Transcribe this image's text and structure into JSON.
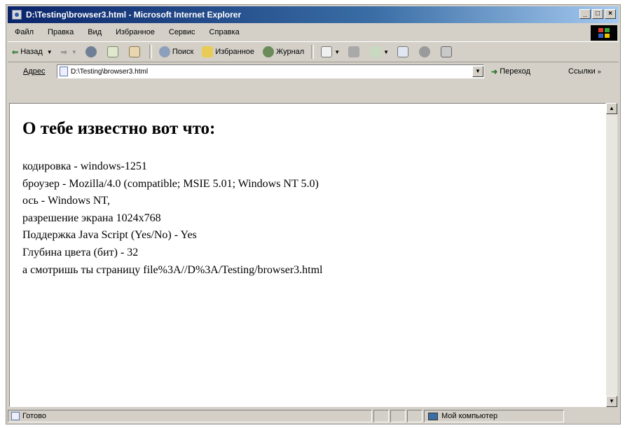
{
  "window": {
    "title": "D:\\Testing\\browser3.html - Microsoft Internet Explorer"
  },
  "menu": {
    "items": [
      "Файл",
      "Правка",
      "Вид",
      "Избранное",
      "Сервис",
      "Справка"
    ]
  },
  "toolbar": {
    "back_label": "Назад",
    "search_label": "Поиск",
    "favorites_label": "Избранное",
    "history_label": "Журнал"
  },
  "address_bar": {
    "label": "Адрес",
    "value": "D:\\Testing\\browser3.html",
    "go_label": "Переход",
    "links_label": "Ссылки"
  },
  "page": {
    "heading": "О тебе известно вот что:",
    "lines": [
      "кодировка - windows-1251",
      "броузер - Mozilla/4.0 (compatible; MSIE 5.01; Windows NT 5.0)",
      "ось - Windows NT,",
      "разрешение экрана 1024x768",
      "Поддержка Java Script (Yes/No) - Yes",
      "Глубина цвета (бит) - 32",
      "а смотришь ты страницу file%3A//D%3A/Testing/browser3.html"
    ]
  },
  "status": {
    "left": "Готово",
    "zone": "Мой компьютер"
  },
  "colors": {
    "titlebar": "#0a246a",
    "chrome": "#d4d0c8"
  }
}
